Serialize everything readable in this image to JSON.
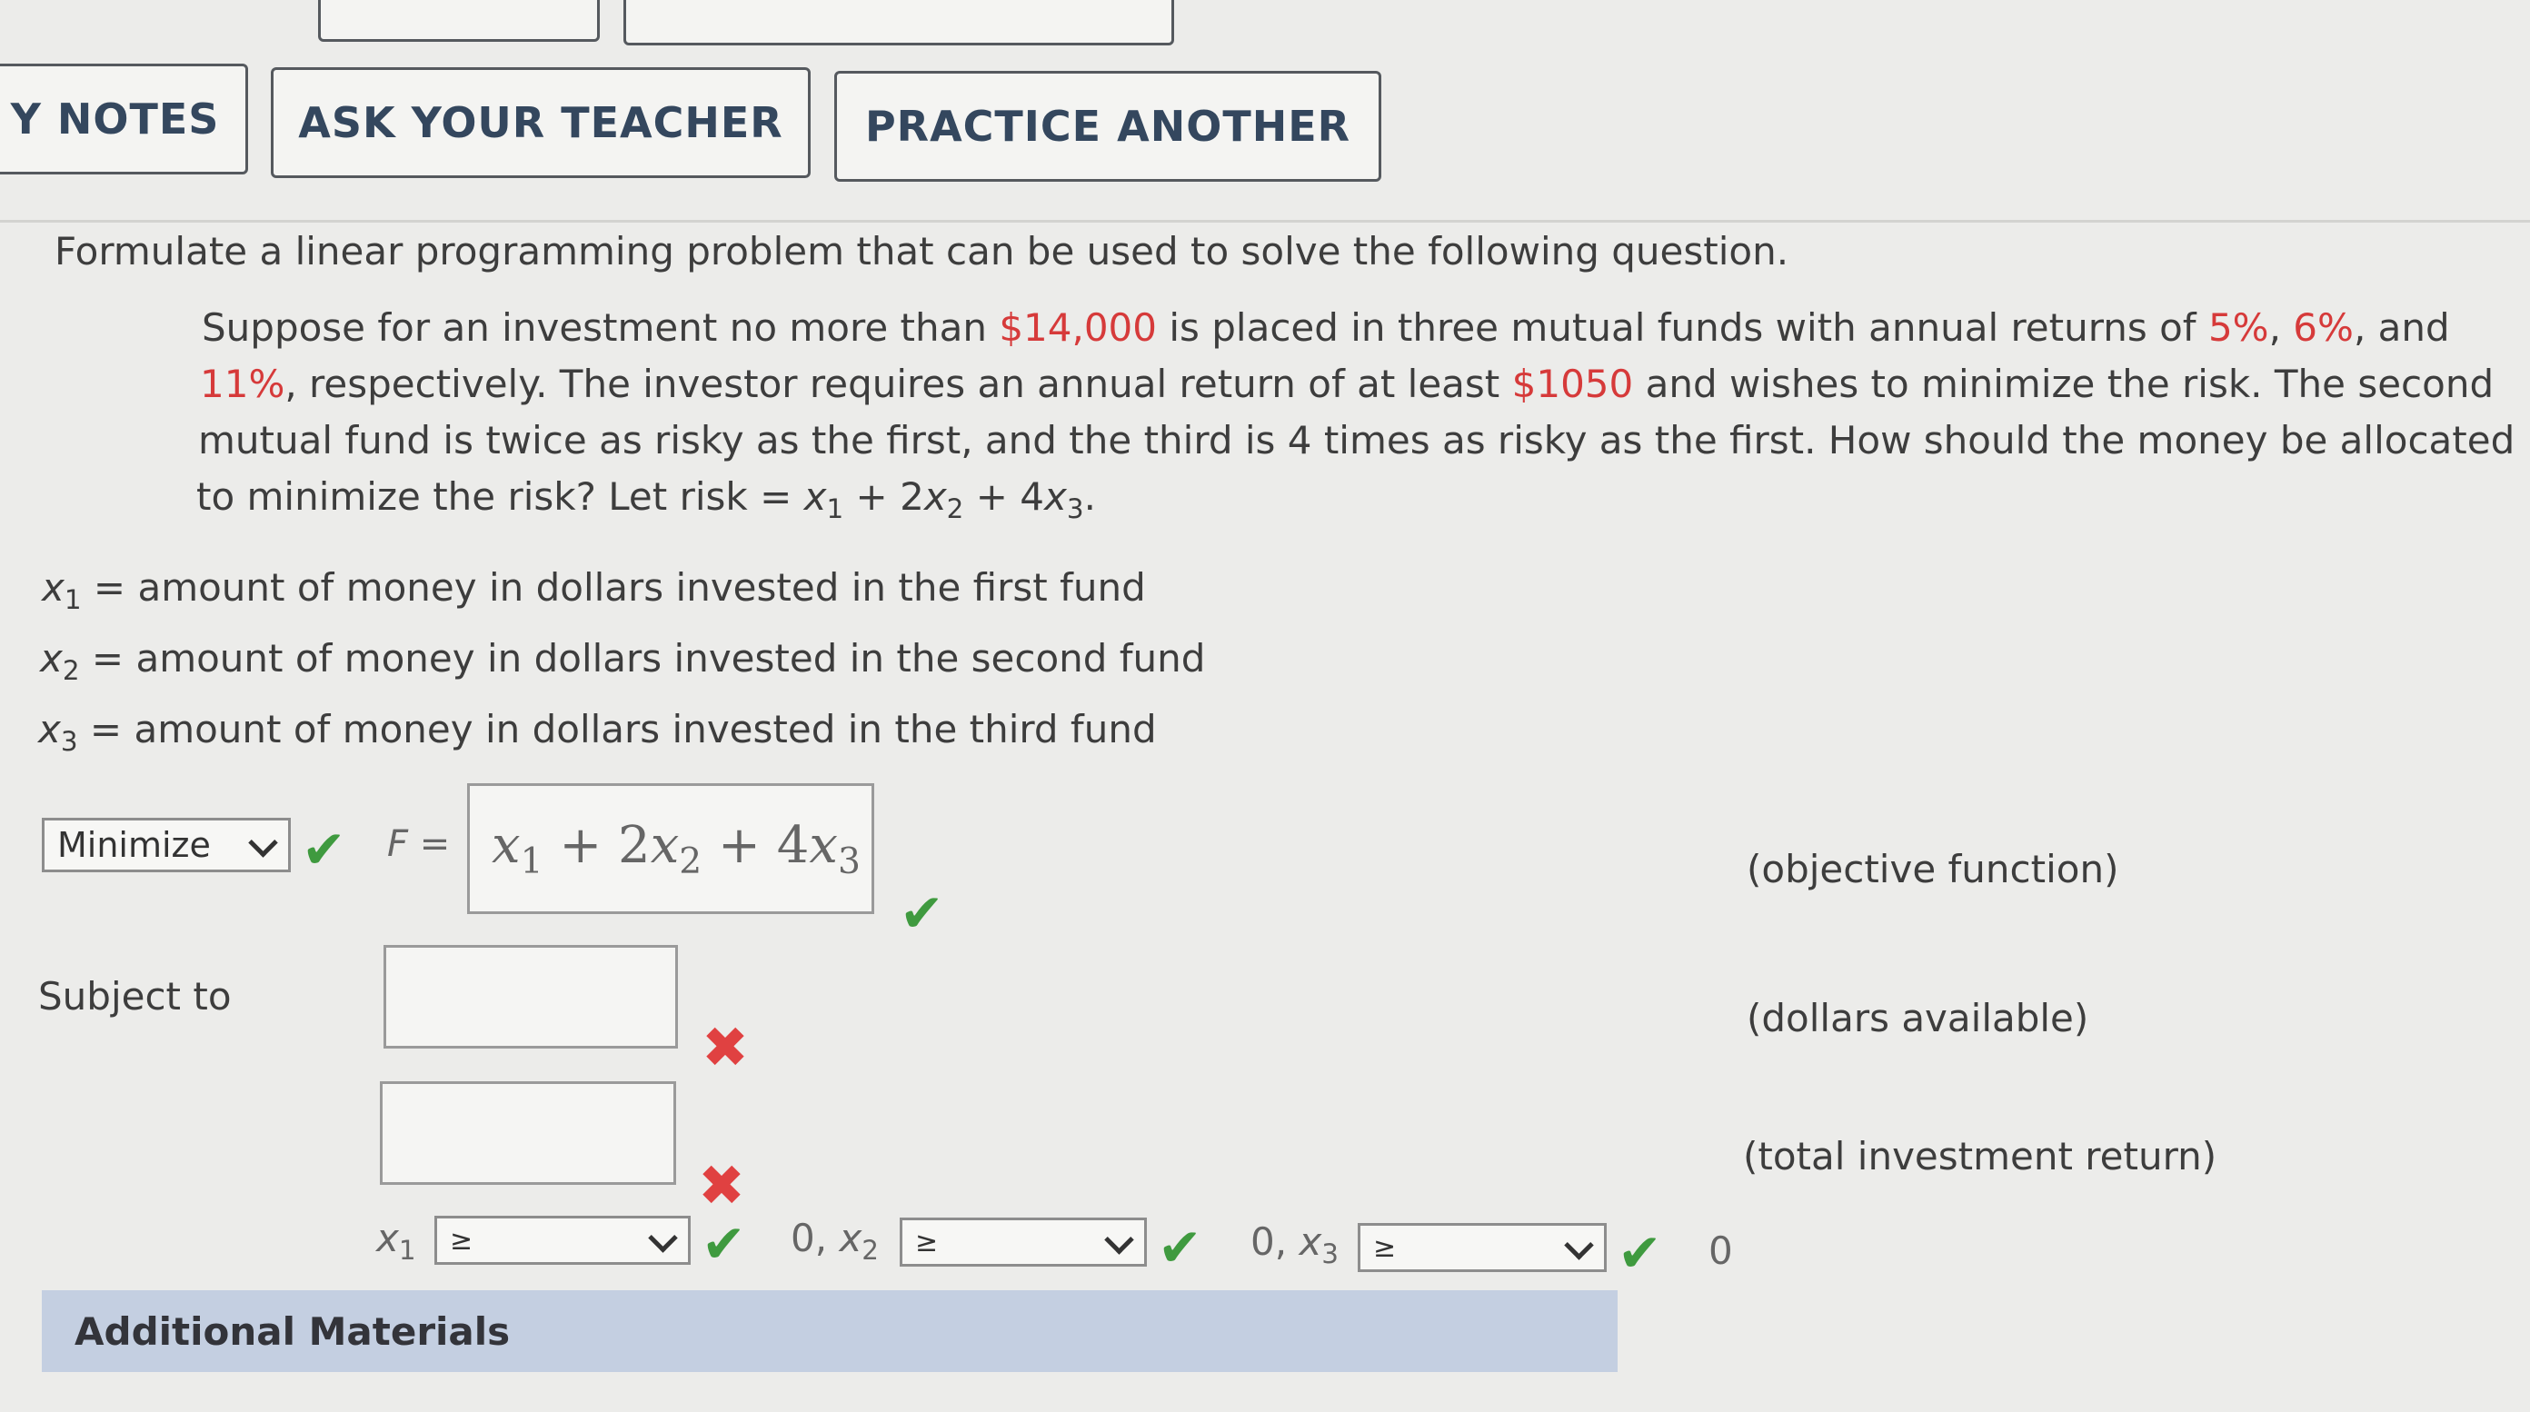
{
  "toolbar": {
    "my_notes_label": "Y NOTES",
    "ask_teacher_label": "ASK YOUR TEACHER",
    "practice_another_label": "PRACTICE ANOTHER"
  },
  "problem": {
    "instruction": "Formulate a linear programming problem that can be used to solve the following question.",
    "line1_pre": "Suppose for an investment no more than ",
    "line1_amount": "$14,000",
    "line1_mid": " is placed in three mutual funds with annual returns of ",
    "rate1": "5%",
    "sep1": ", ",
    "rate2": "6%",
    "line1_post": ", and",
    "rate3": "11%",
    "line2_mid": ", respectively. The investor requires an annual return of at least ",
    "line2_amount": "$1050",
    "line2_post": " and wishes to minimize the risk. The second",
    "line3": "mutual fund is twice as risky as the first, and the third is 4 times as risky as the first. How should the money be allocated",
    "line4_pre": "to minimize the risk? Let risk = ",
    "risk_formula": {
      "v1": "x",
      "s1": "1",
      "plus1": " + 2",
      "v2": "x",
      "s2": "2",
      "plus2": " + 4",
      "v3": "x",
      "s3": "3",
      "end": "."
    }
  },
  "definitions": [
    {
      "var": "x",
      "sub": "1",
      "text": " = amount of money in dollars invested in the first fund"
    },
    {
      "var": "x",
      "sub": "2",
      "text": " = amount of money in dollars invested in the second fund"
    },
    {
      "var": "x",
      "sub": "3",
      "text": " = amount of money in dollars invested in the third fund"
    }
  ],
  "objective": {
    "select_value": "Minimize",
    "f_label": "F =",
    "expression": {
      "v1": "x",
      "s1": "1",
      "plus1": " + 2",
      "v2": "x",
      "s2": "2",
      "plus2": " + 4",
      "v3": "x",
      "s3": "3"
    },
    "note": "(objective function)"
  },
  "constraints": {
    "subject_to": "Subject to",
    "note1": "(dollars available)",
    "note2": "(total investment return)"
  },
  "nonneg": {
    "x1_var": "x",
    "x1_sub": "1",
    "x1_select": "≥",
    "sep2_pre": "0, ",
    "x2_var": "x",
    "x2_sub": "2",
    "x2_select": "≥",
    "sep3_pre": "0, ",
    "x3_var": "x",
    "x3_sub": "3",
    "x3_select": "≥",
    "final_zero": "0"
  },
  "additional_materials": "Additional Materials",
  "icons": {
    "check": "✔",
    "cross": "✖"
  },
  "colors": {
    "accent_red": "#d63a3a",
    "correct_green": "#3f9a3f",
    "wrong_red": "#e04141",
    "materials_bar": "#c4cfe1"
  }
}
